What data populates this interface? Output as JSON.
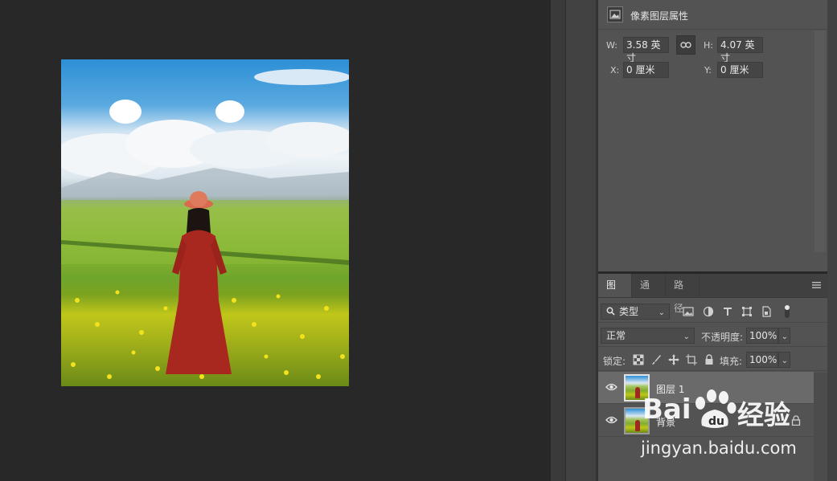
{
  "properties": {
    "title": "像素图层属性",
    "w_label": "W:",
    "w_value": "3.58 英寸",
    "h_label": "H:",
    "h_value": "4.07 英寸",
    "x_label": "X:",
    "x_value": "0 厘米",
    "y_label": "Y:",
    "y_value": "0 厘米"
  },
  "layers_panel": {
    "tabs": [
      {
        "label": "图层",
        "active": true
      },
      {
        "label": "通道",
        "active": false
      },
      {
        "label": "路径",
        "active": false
      }
    ],
    "filter_kind": "类型",
    "blend_mode": "正常",
    "opacity_label": "不透明度:",
    "opacity_value": "100%",
    "lock_label": "锁定:",
    "fill_label": "填充:",
    "fill_value": "100%",
    "layers": [
      {
        "name": "图层 1",
        "selected": true,
        "locked": false
      },
      {
        "name": "背景",
        "selected": false,
        "locked": true
      }
    ]
  },
  "watermark": {
    "brand": "Bai",
    "suffix": "经验",
    "url": "jingyan.baidu.com"
  },
  "colors": {
    "canvas_bg": "#282828",
    "panel_bg": "#535353",
    "selected_layer": "#6a6a6a"
  }
}
